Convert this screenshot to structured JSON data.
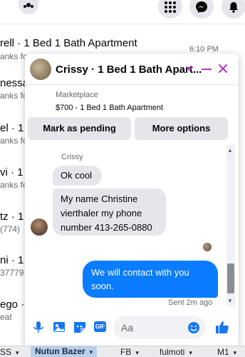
{
  "topbar": {
    "icons": [
      "groups-icon",
      "menu-grid-icon",
      "messenger-icon",
      "notifications-icon"
    ]
  },
  "background_list": {
    "rows": [
      {
        "title": "rell · 1 Bed 1 Bath Apartment",
        "subtitle": "anks fo",
        "time": "6:10 PM"
      },
      {
        "title": "nessa",
        "subtitle": "anks fo"
      },
      {
        "title": "el · 1 B",
        "subtitle": "anks fo"
      },
      {
        "title": "vi · 1 B",
        "subtitle": "anks fo"
      },
      {
        "title": "tz · 1",
        "subtitle": "(774)"
      },
      {
        "title": "ni · 1",
        "subtitle": "37779"
      },
      {
        "title": "ego ·",
        "subtitle": "eat"
      }
    ]
  },
  "chat": {
    "title": "Crissy · 1 Bed 1 Bath Apart...",
    "marketplace_label": "Marketplace",
    "listing": "$700 - 1 Bed 1 Bath Apartment",
    "buttons": {
      "mark_pending": "Mark as pending",
      "more_options": "More options"
    },
    "sender_name": "Crissy",
    "messages": [
      {
        "direction": "in",
        "text": "Ok cool"
      },
      {
        "direction": "in",
        "text": "My name Christine vierthaler  my phone number 413-265-0880"
      },
      {
        "direction": "out",
        "text": "We will contact with you soon."
      }
    ],
    "sent_status": "Sent 2m ago",
    "composer": {
      "placeholder": "Aa",
      "gif_label": "GIF"
    },
    "accent_color": "#b931c9",
    "outgoing_bubble_color": "#0a7cff"
  },
  "tabbar": {
    "tabs": [
      {
        "label": "SS",
        "caret": "▾"
      },
      {
        "label": "Nutun Bazer",
        "caret": "▾",
        "active": true
      },
      {
        "label": "FB",
        "caret": "▾"
      },
      {
        "label": "fulmoti",
        "caret": "▾"
      },
      {
        "label": "M1",
        "caret": "▾"
      }
    ]
  }
}
